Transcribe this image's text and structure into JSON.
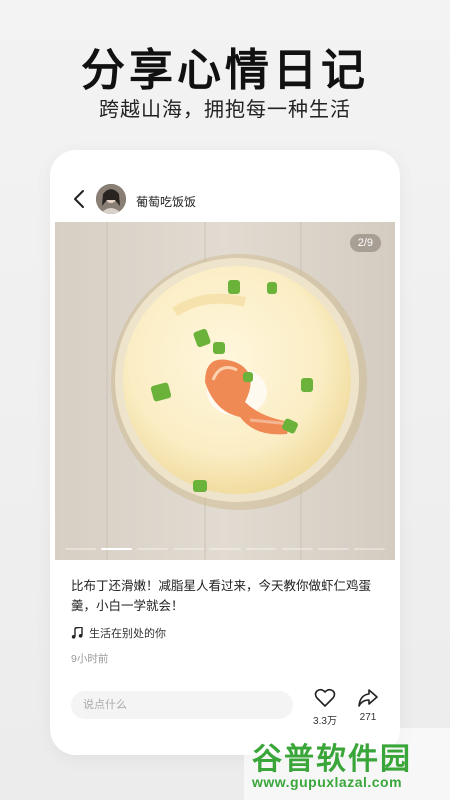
{
  "promo": {
    "headline": "分享心情日记",
    "subline": "跨越山海，拥抱每一种生活"
  },
  "post": {
    "username": "葡萄吃饭饭",
    "page_indicator": "2/9",
    "image_count": 9,
    "current_image": 2,
    "caption": "比布丁还滑嫩！减脂星人看过来，今天教你做虾仁鸡蛋羹，小白一学就会！",
    "music": "生活在别处的你",
    "time": "9小时前"
  },
  "footer": {
    "comment_placeholder": "说点什么",
    "like_count": "3.3万",
    "share_count": "271"
  },
  "watermark": {
    "title": "谷普软件园",
    "url": "www.gupuxlazal.com"
  },
  "colors": {
    "background": "#efefef",
    "card": "#ffffff",
    "watermark_green": "#3aa63a"
  },
  "icons": [
    "back-icon",
    "music-note-icon",
    "heart-icon",
    "share-icon"
  ]
}
